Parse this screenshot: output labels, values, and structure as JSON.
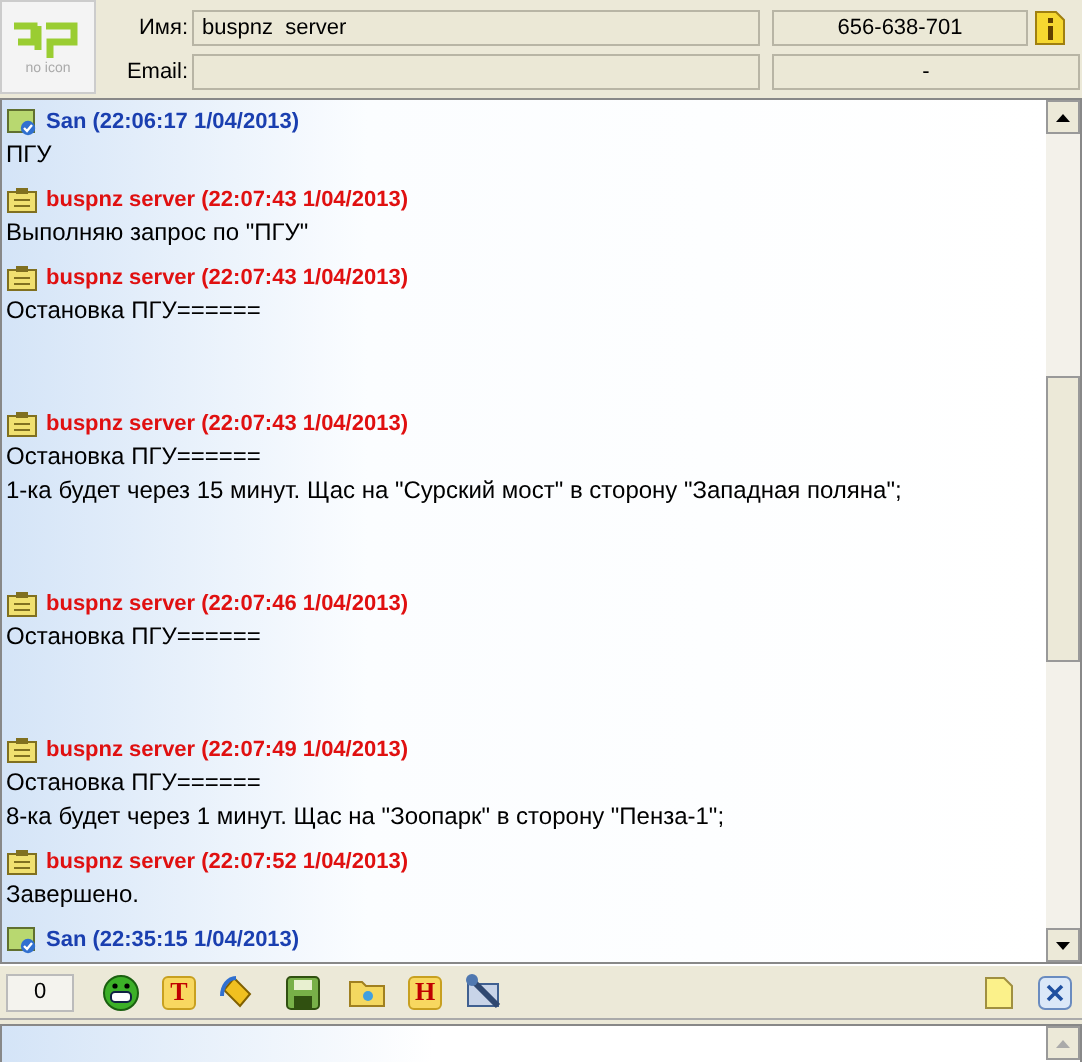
{
  "contact": {
    "logo_caption": "no icon",
    "name_label": "Имя:",
    "name": "buspnz  server",
    "uin": "656-638-701",
    "email_label": "Email:",
    "email_extra": "-"
  },
  "messages": [
    {
      "kind": "outgoing",
      "header": "San (22:06:17 1/04/2013)",
      "text": "ПГУ"
    },
    {
      "kind": "incoming",
      "header": "buspnz server (22:07:43 1/04/2013)",
      "text": "Выполняю запрос по \"ПГУ\""
    },
    {
      "kind": "incoming",
      "header": "buspnz server (22:07:43 1/04/2013)",
      "text": "Остановка ПГУ======\n\n"
    },
    {
      "kind": "incoming",
      "header": "buspnz server (22:07:43 1/04/2013)",
      "text": "Остановка ПГУ======\n1-ка будет через 15 минут. Щас на \"Сурский мост\" в сторону \"Западная поляна\";\n\n"
    },
    {
      "kind": "incoming",
      "header": "buspnz server (22:07:46 1/04/2013)",
      "text": "Остановка ПГУ======\n\n"
    },
    {
      "kind": "incoming",
      "header": "buspnz server (22:07:49 1/04/2013)",
      "text": "Остановка ПГУ======\n8-ка будет через 1 минут. Щас на \"Зоопарк\" в сторону \"Пенза-1\";"
    },
    {
      "kind": "incoming",
      "header": "buspnz server (22:07:52 1/04/2013)",
      "text": "Завершено."
    },
    {
      "kind": "outgoing",
      "header": "San (22:35:15 1/04/2013)"
    }
  ],
  "toolbar": {
    "counter": "0",
    "tools": [
      {
        "kind": "smiley"
      },
      {
        "kind": "letter",
        "label": "T"
      },
      {
        "kind": "paint"
      },
      {
        "kind": "save"
      },
      {
        "kind": "folder"
      },
      {
        "kind": "letter",
        "label": "H"
      },
      {
        "kind": "tools"
      }
    ]
  }
}
